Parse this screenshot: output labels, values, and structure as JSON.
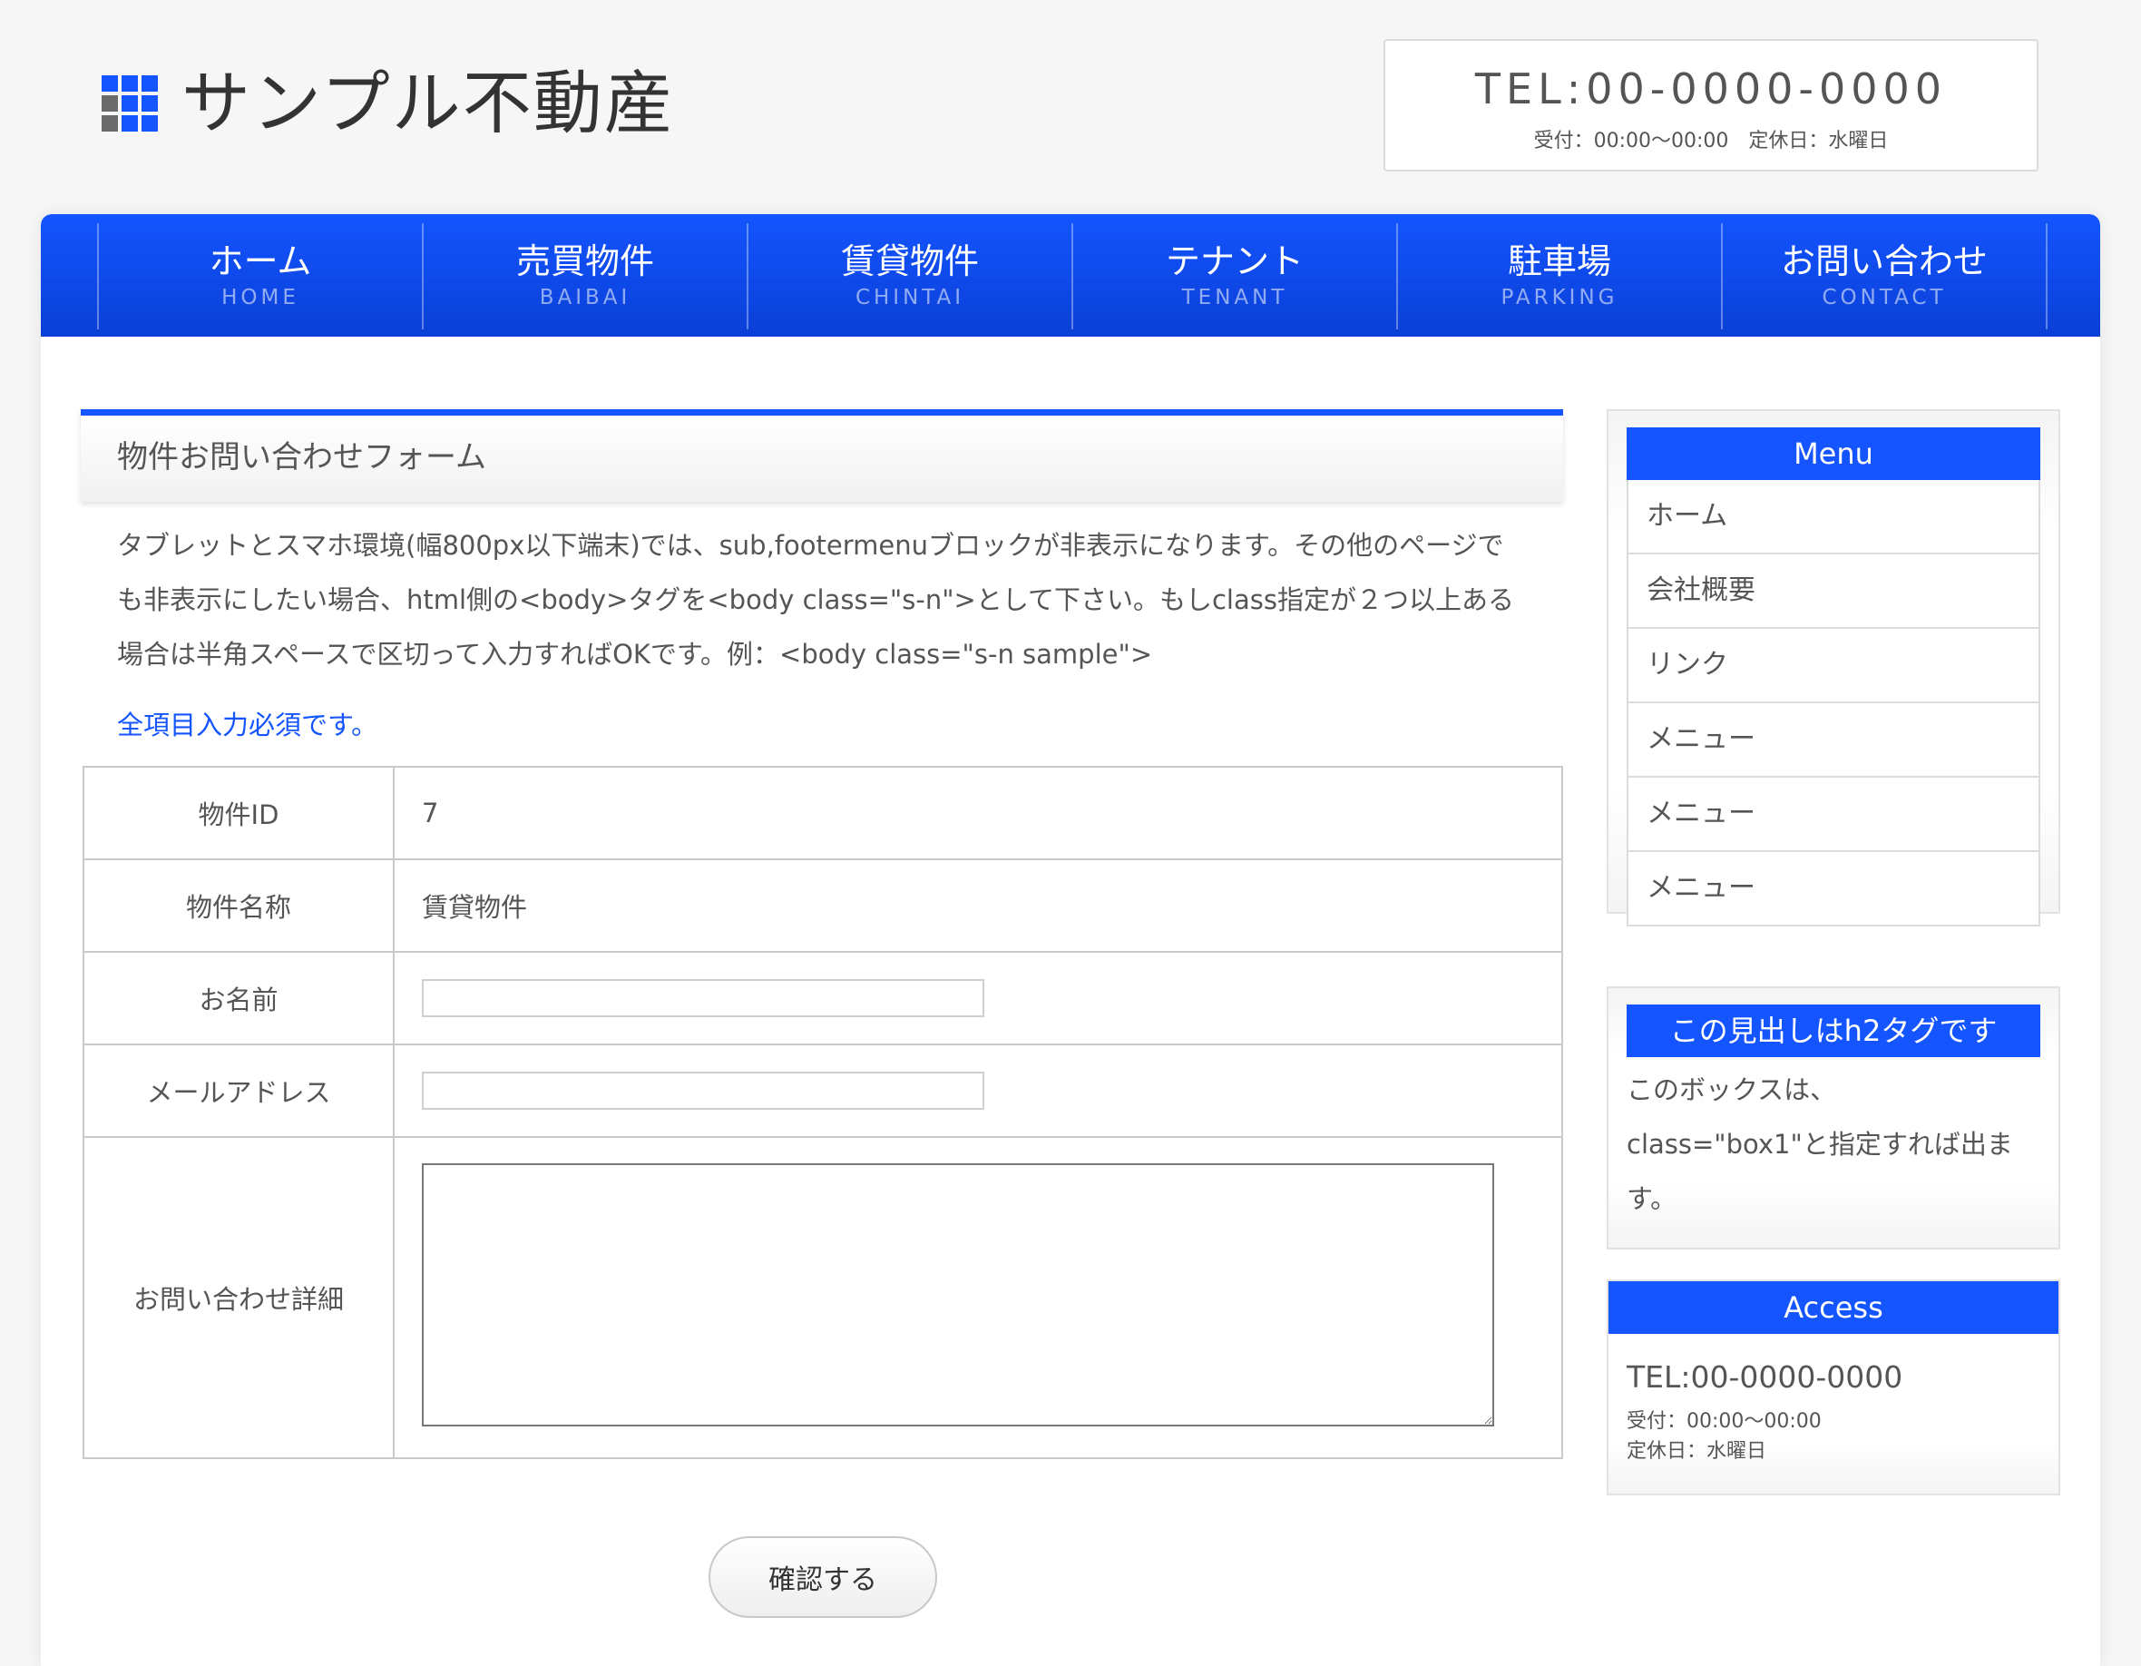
{
  "header": {
    "site_title": "サンプル不動産",
    "tel": "TEL:00-0000-0000",
    "hours_line": "受付：00:00〜00:00　定休日：水曜日"
  },
  "nav": {
    "items": [
      {
        "ja": "ホーム",
        "en": "HOME"
      },
      {
        "ja": "売買物件",
        "en": "BAIBAI"
      },
      {
        "ja": "賃貸物件",
        "en": "CHINTAI"
      },
      {
        "ja": "テナント",
        "en": "TENANT"
      },
      {
        "ja": "駐車場",
        "en": "PARKING"
      },
      {
        "ja": "お問い合わせ",
        "en": "CONTACT"
      }
    ]
  },
  "main": {
    "heading": "物件お問い合わせフォーム",
    "intro": "タブレットとスマホ環境(幅800px以下端末)では、sub,footermenuブロックが非表示になります。その他のページでも非表示にしたい場合、html側の<body>タグを<body class=\"s-n\">として下さい。もしclass指定が２つ以上ある場合は半角スペースで区切って入力すればOKです。例：<body class=\"s-n sample\">",
    "required_note": "全項目入力必須です。",
    "form": {
      "property_id_label": "物件ID",
      "property_id_value": "7",
      "property_name_label": "物件名称",
      "property_name_value": "賃貸物件",
      "name_label": "お名前",
      "name_value": "",
      "email_label": "メールアドレス",
      "email_value": "",
      "detail_label": "お問い合わせ詳細",
      "detail_value": "",
      "confirm_label": "確認する"
    }
  },
  "sidebar": {
    "menu_title": "Menu",
    "menu_items": [
      "ホーム",
      "会社概要",
      "リンク",
      "メニュー",
      "メニュー",
      "メニュー"
    ],
    "h2box_title": "この見出しはh2タグです",
    "h2box_text": "このボックスは、class=\"box1\"と指定すれば出ます。",
    "access_title": "Access",
    "access_tel": "TEL:00-0000-0000",
    "access_hours": "受付：00:00〜00:00",
    "access_holiday": "定休日：水曜日"
  },
  "colors": {
    "accent": "#1455ff",
    "text": "#555555",
    "background": "#f6f6f6"
  }
}
